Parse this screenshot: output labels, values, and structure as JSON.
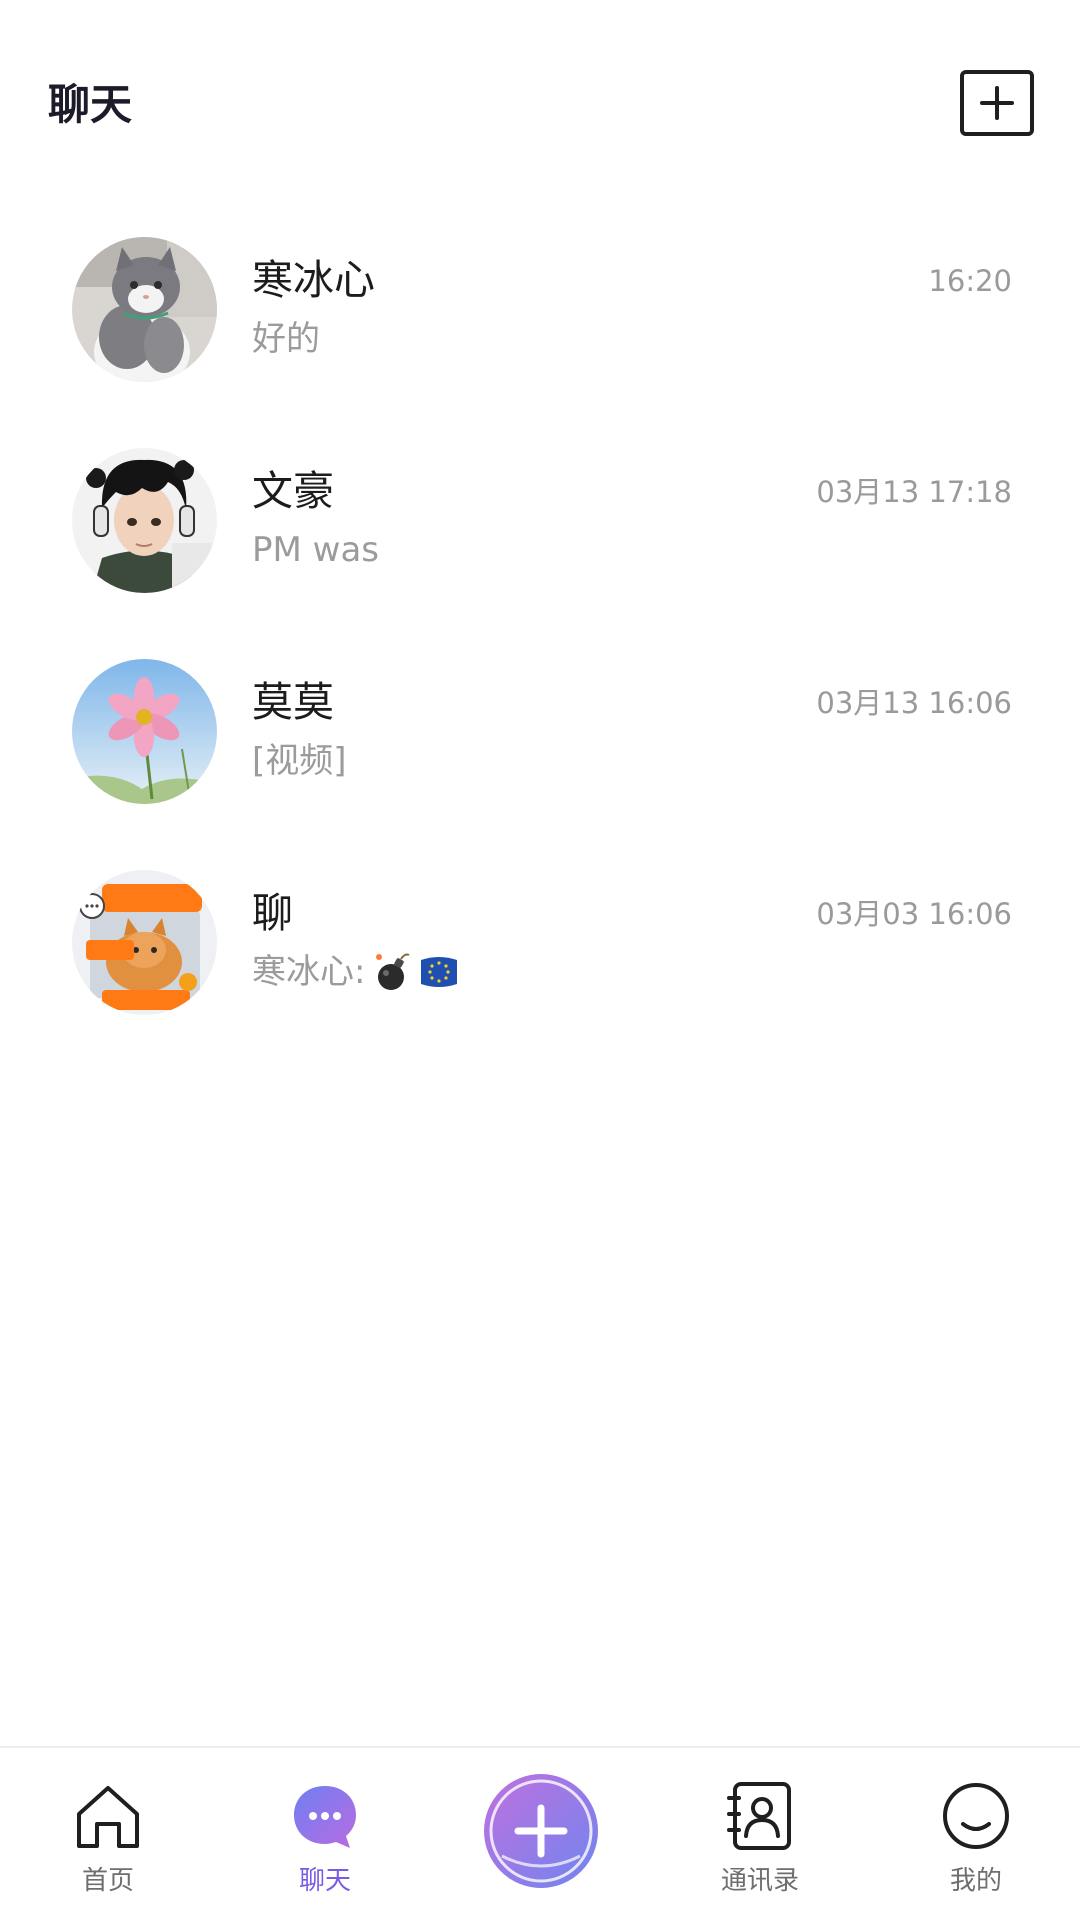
{
  "header": {
    "title": "聊天",
    "add_icon": "plus-square-icon"
  },
  "chats": [
    {
      "name": "寒冰心",
      "time": "16:20",
      "preview": "好的",
      "avatar": "cat-photo"
    },
    {
      "name": "文豪",
      "time": "03月13 17:18",
      "preview": "PM was",
      "avatar": "anime-boy-headphones"
    },
    {
      "name": "莫莫",
      "time": "03月13 16:06",
      "preview": "[视频]",
      "avatar": "pink-flower-sky"
    },
    {
      "name": "聊",
      "time": "03月03 16:06",
      "preview": "寒冰心: ",
      "preview_emojis": [
        "bomb-icon",
        "eu-flag-icon"
      ],
      "avatar": "pet-group-sticker"
    }
  ],
  "nav": {
    "items": [
      {
        "label": "首页",
        "icon": "home-icon",
        "active": false
      },
      {
        "label": "聊天",
        "icon": "chat-bubble-icon",
        "active": true
      },
      {
        "label": "",
        "icon": "plus-circle-icon",
        "active": false
      },
      {
        "label": "通讯录",
        "icon": "contacts-icon",
        "active": false
      },
      {
        "label": "我的",
        "icon": "smile-icon",
        "active": false
      }
    ]
  },
  "colors": {
    "accent": "#7a5be8",
    "text_primary": "#1c1c1c",
    "text_secondary": "#9a9a9a"
  }
}
